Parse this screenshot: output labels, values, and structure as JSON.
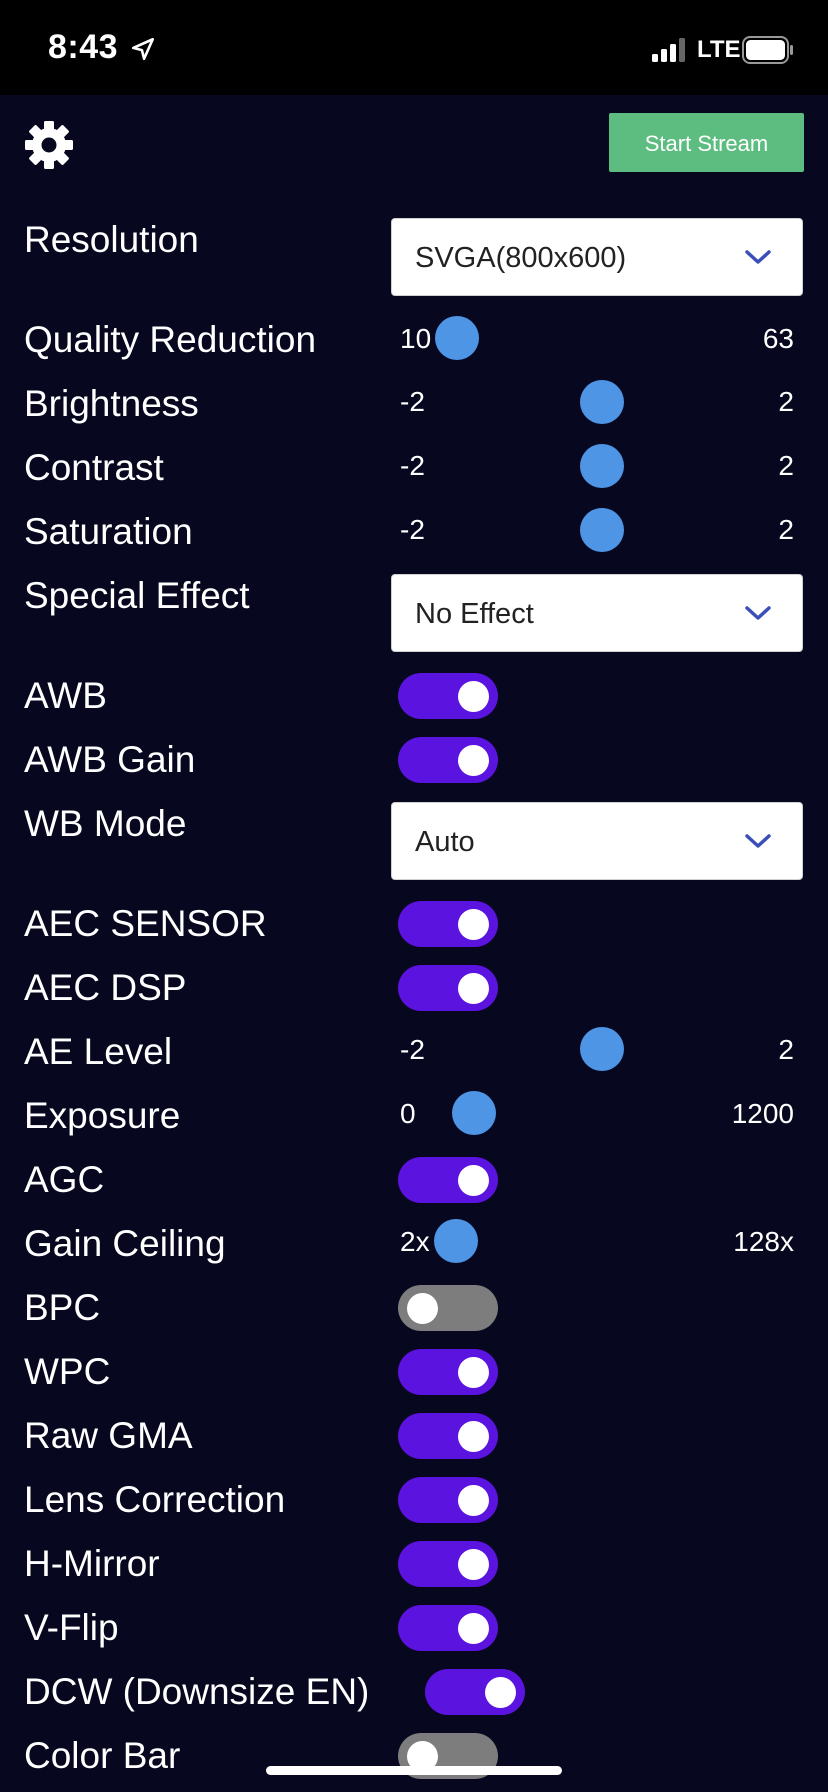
{
  "status_bar": {
    "time": "8:43",
    "network": "LTE"
  },
  "header": {
    "start_stream_label": "Start Stream"
  },
  "selects": {
    "resolution": {
      "label": "Resolution",
      "value": "SVGA(800x600)"
    },
    "special_effect": {
      "label": "Special Effect",
      "value": "No Effect"
    },
    "wb_mode": {
      "label": "WB Mode",
      "value": "Auto"
    }
  },
  "sliders": {
    "quality": {
      "label": "Quality Reduction",
      "min": "10",
      "max": "63",
      "level": 0.0
    },
    "brightness": {
      "label": "Brightness",
      "min": "-2",
      "max": "2",
      "level": 0.5
    },
    "contrast": {
      "label": "Contrast",
      "min": "-2",
      "max": "2",
      "level": 0.5
    },
    "saturation": {
      "label": "Saturation",
      "min": "-2",
      "max": "2",
      "level": 0.5
    },
    "ae_level": {
      "label": "AE Level",
      "min": "-2",
      "max": "2",
      "level": 0.5
    },
    "exposure": {
      "label": "Exposure",
      "min": "0",
      "max": "1200",
      "level": 0.12
    },
    "gain_ceiling": {
      "label": "Gain Ceiling",
      "min": "2x",
      "max": "128x",
      "level": 0.0
    }
  },
  "toggles": {
    "awb": {
      "label": "AWB",
      "on": true
    },
    "awb_gain": {
      "label": "AWB Gain",
      "on": true
    },
    "aec_sensor": {
      "label": "AEC SENSOR",
      "on": true
    },
    "aec_dsp": {
      "label": "AEC DSP",
      "on": true
    },
    "agc": {
      "label": "AGC",
      "on": true
    },
    "bpc": {
      "label": "BPC",
      "on": false
    },
    "wpc": {
      "label": "WPC",
      "on": true
    },
    "raw_gma": {
      "label": "Raw GMA",
      "on": true
    },
    "lens_correction": {
      "label": "Lens Correction",
      "on": true
    },
    "h_mirror": {
      "label": "H-Mirror",
      "on": true
    },
    "v_flip": {
      "label": "V-Flip",
      "on": true
    },
    "dcw": {
      "label": "DCW (Downsize EN)",
      "on": true
    },
    "color_bar": {
      "label": "Color Bar",
      "on": false
    }
  },
  "colors": {
    "background": "#07071f",
    "toggle_on": "#5b14e0",
    "toggle_off": "#7d7d7d",
    "slider_thumb": "#4f95e6",
    "start_button": "#5dbd81"
  },
  "icons": {
    "settings": "gear-icon",
    "location": "location-arrow-icon",
    "signal": "cellular-signal-icon",
    "battery": "battery-icon",
    "dropdown": "chevron-down-icon"
  }
}
